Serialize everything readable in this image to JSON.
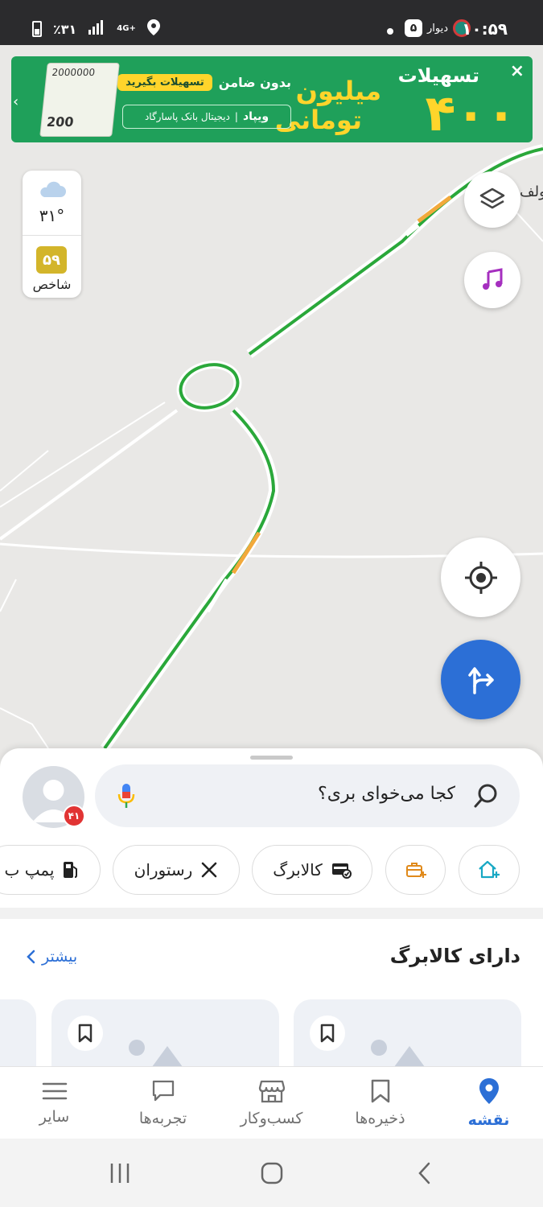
{
  "status_bar": {
    "time": "۱۰:۵۹",
    "app_label": "دیوار",
    "badge": "۵",
    "battery": "٪۳۱",
    "network": "4G+"
  },
  "ad_banner": {
    "title": "تسهیلات",
    "amount": "۴۰۰",
    "unit_line1": "میلیون",
    "unit_line2": "تومانی",
    "no_guarantor": "بدون ضامن",
    "cta_pill": "تسهیلات بگیرید",
    "bank_brand": "ویپاد",
    "bank_name": "دیجیتال بانک پاسارگاد",
    "money_top": "2000000",
    "money_bottom": "200"
  },
  "weather": {
    "temperature": "۳۱°",
    "aqi_value": "۵۹",
    "aqi_label": "شاخص"
  },
  "map": {
    "partial_place_label": "ولف"
  },
  "search": {
    "placeholder": "کجا می‌خوای بری؟",
    "notification_count": "۴۱"
  },
  "chips": [
    {
      "label": "پمپ ب",
      "icon": "fuel-icon"
    },
    {
      "label": "رستوران",
      "icon": "restaurant-icon"
    },
    {
      "label": "کالابرگ",
      "icon": "voucher-card-icon"
    },
    {
      "label": "",
      "icon": "work-briefcase-icon"
    },
    {
      "label": "",
      "icon": "home-add-icon"
    }
  ],
  "section": {
    "title": "دارای کالابرگ",
    "more_label": "بیشتر"
  },
  "bottom_nav": [
    {
      "label": "نقشه",
      "icon": "map-pin-icon",
      "active": true
    },
    {
      "label": "ذخیره‌ها",
      "icon": "bookmark-icon",
      "active": false
    },
    {
      "label": "کسب‌وکار",
      "icon": "store-icon",
      "active": false
    },
    {
      "label": "تجربه‌ها",
      "icon": "chat-icon",
      "active": false
    },
    {
      "label": "سایر",
      "icon": "menu-icon",
      "active": false
    }
  ],
  "colors": {
    "accent": "#2c6fd6",
    "route_green": "#2aa83a",
    "route_orange": "#f2a93b",
    "ad_green": "#1fa05a",
    "ad_yellow": "#ffd52b",
    "aqi_yellow": "#d3b52a",
    "badge_red": "#e13434"
  }
}
